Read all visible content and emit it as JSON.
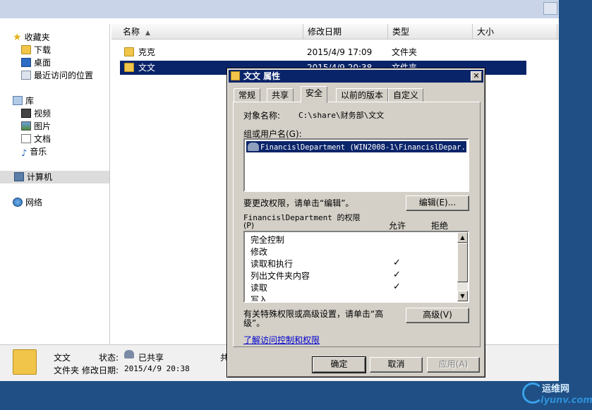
{
  "explorer": {
    "nav": {
      "favorites": "收藏夹",
      "downloads": "下载",
      "desktop": "桌面",
      "recent": "最近访问的位置",
      "libraries": "库",
      "videos": "视频",
      "pictures": "图片",
      "documents": "文档",
      "music": "音乐",
      "computer": "计算机",
      "network": "网络"
    },
    "columns": {
      "name": "名称",
      "modified": "修改日期",
      "type": "类型",
      "size": "大小"
    },
    "files": [
      {
        "name": "克克",
        "modified": "2015/4/9 17:09",
        "type": "文件夹"
      },
      {
        "name": "文文",
        "modified": "2015/4/9 20:38",
        "type": "文件夹"
      }
    ],
    "details": {
      "name": "文文",
      "type": "文件夹",
      "status_label": "状态:",
      "status_value": "已共享",
      "modified_label": "修改日期:",
      "modified_value": "2015/4/9 20:38",
      "extra": "共"
    }
  },
  "dialog": {
    "title": "文文 属性",
    "tabs": [
      "常规",
      "共享",
      "安全",
      "以前的版本",
      "自定义"
    ],
    "active_tab": "安全",
    "object_label": "对象名称:",
    "object_value": "C:\\share\\财务部\\文文",
    "group_label": "组或用户名(G):",
    "users": [
      "FinancislDepartment (WIN2008-1\\FinancislDepar..."
    ],
    "change_hint": "要更改权限，请单击“编辑”。",
    "edit_button": "编辑(E)...",
    "perm_label_line1": "FinancislDepartment 的权限",
    "perm_label_line2": "(P)",
    "allow_header": "允许",
    "deny_header": "拒绝",
    "permissions": [
      {
        "name": "完全控制",
        "allow": "",
        "deny": ""
      },
      {
        "name": "修改",
        "allow": "",
        "deny": ""
      },
      {
        "name": "读取和执行",
        "allow": "✓",
        "deny": ""
      },
      {
        "name": "列出文件夹内容",
        "allow": "✓",
        "deny": ""
      },
      {
        "name": "读取",
        "allow": "✓",
        "deny": ""
      },
      {
        "name": "写入",
        "allow": "",
        "deny": ""
      }
    ],
    "advanced_hint_line1": "有关特殊权限或高级设置，请单击“高",
    "advanced_hint_line2": "级”。",
    "advanced_button": "高级(V)",
    "learn_link": "了解访问控制和权限",
    "ok_button": "确定",
    "cancel_button": "取消",
    "apply_button": "应用(A)",
    "close_glyph": "✕"
  },
  "watermark": {
    "top": "运维网",
    "bottom": "iyunv.com"
  },
  "colors": {
    "selection": "#0a246a",
    "dialog_face": "#d4d0c8",
    "desktop": "#1f4f84"
  }
}
